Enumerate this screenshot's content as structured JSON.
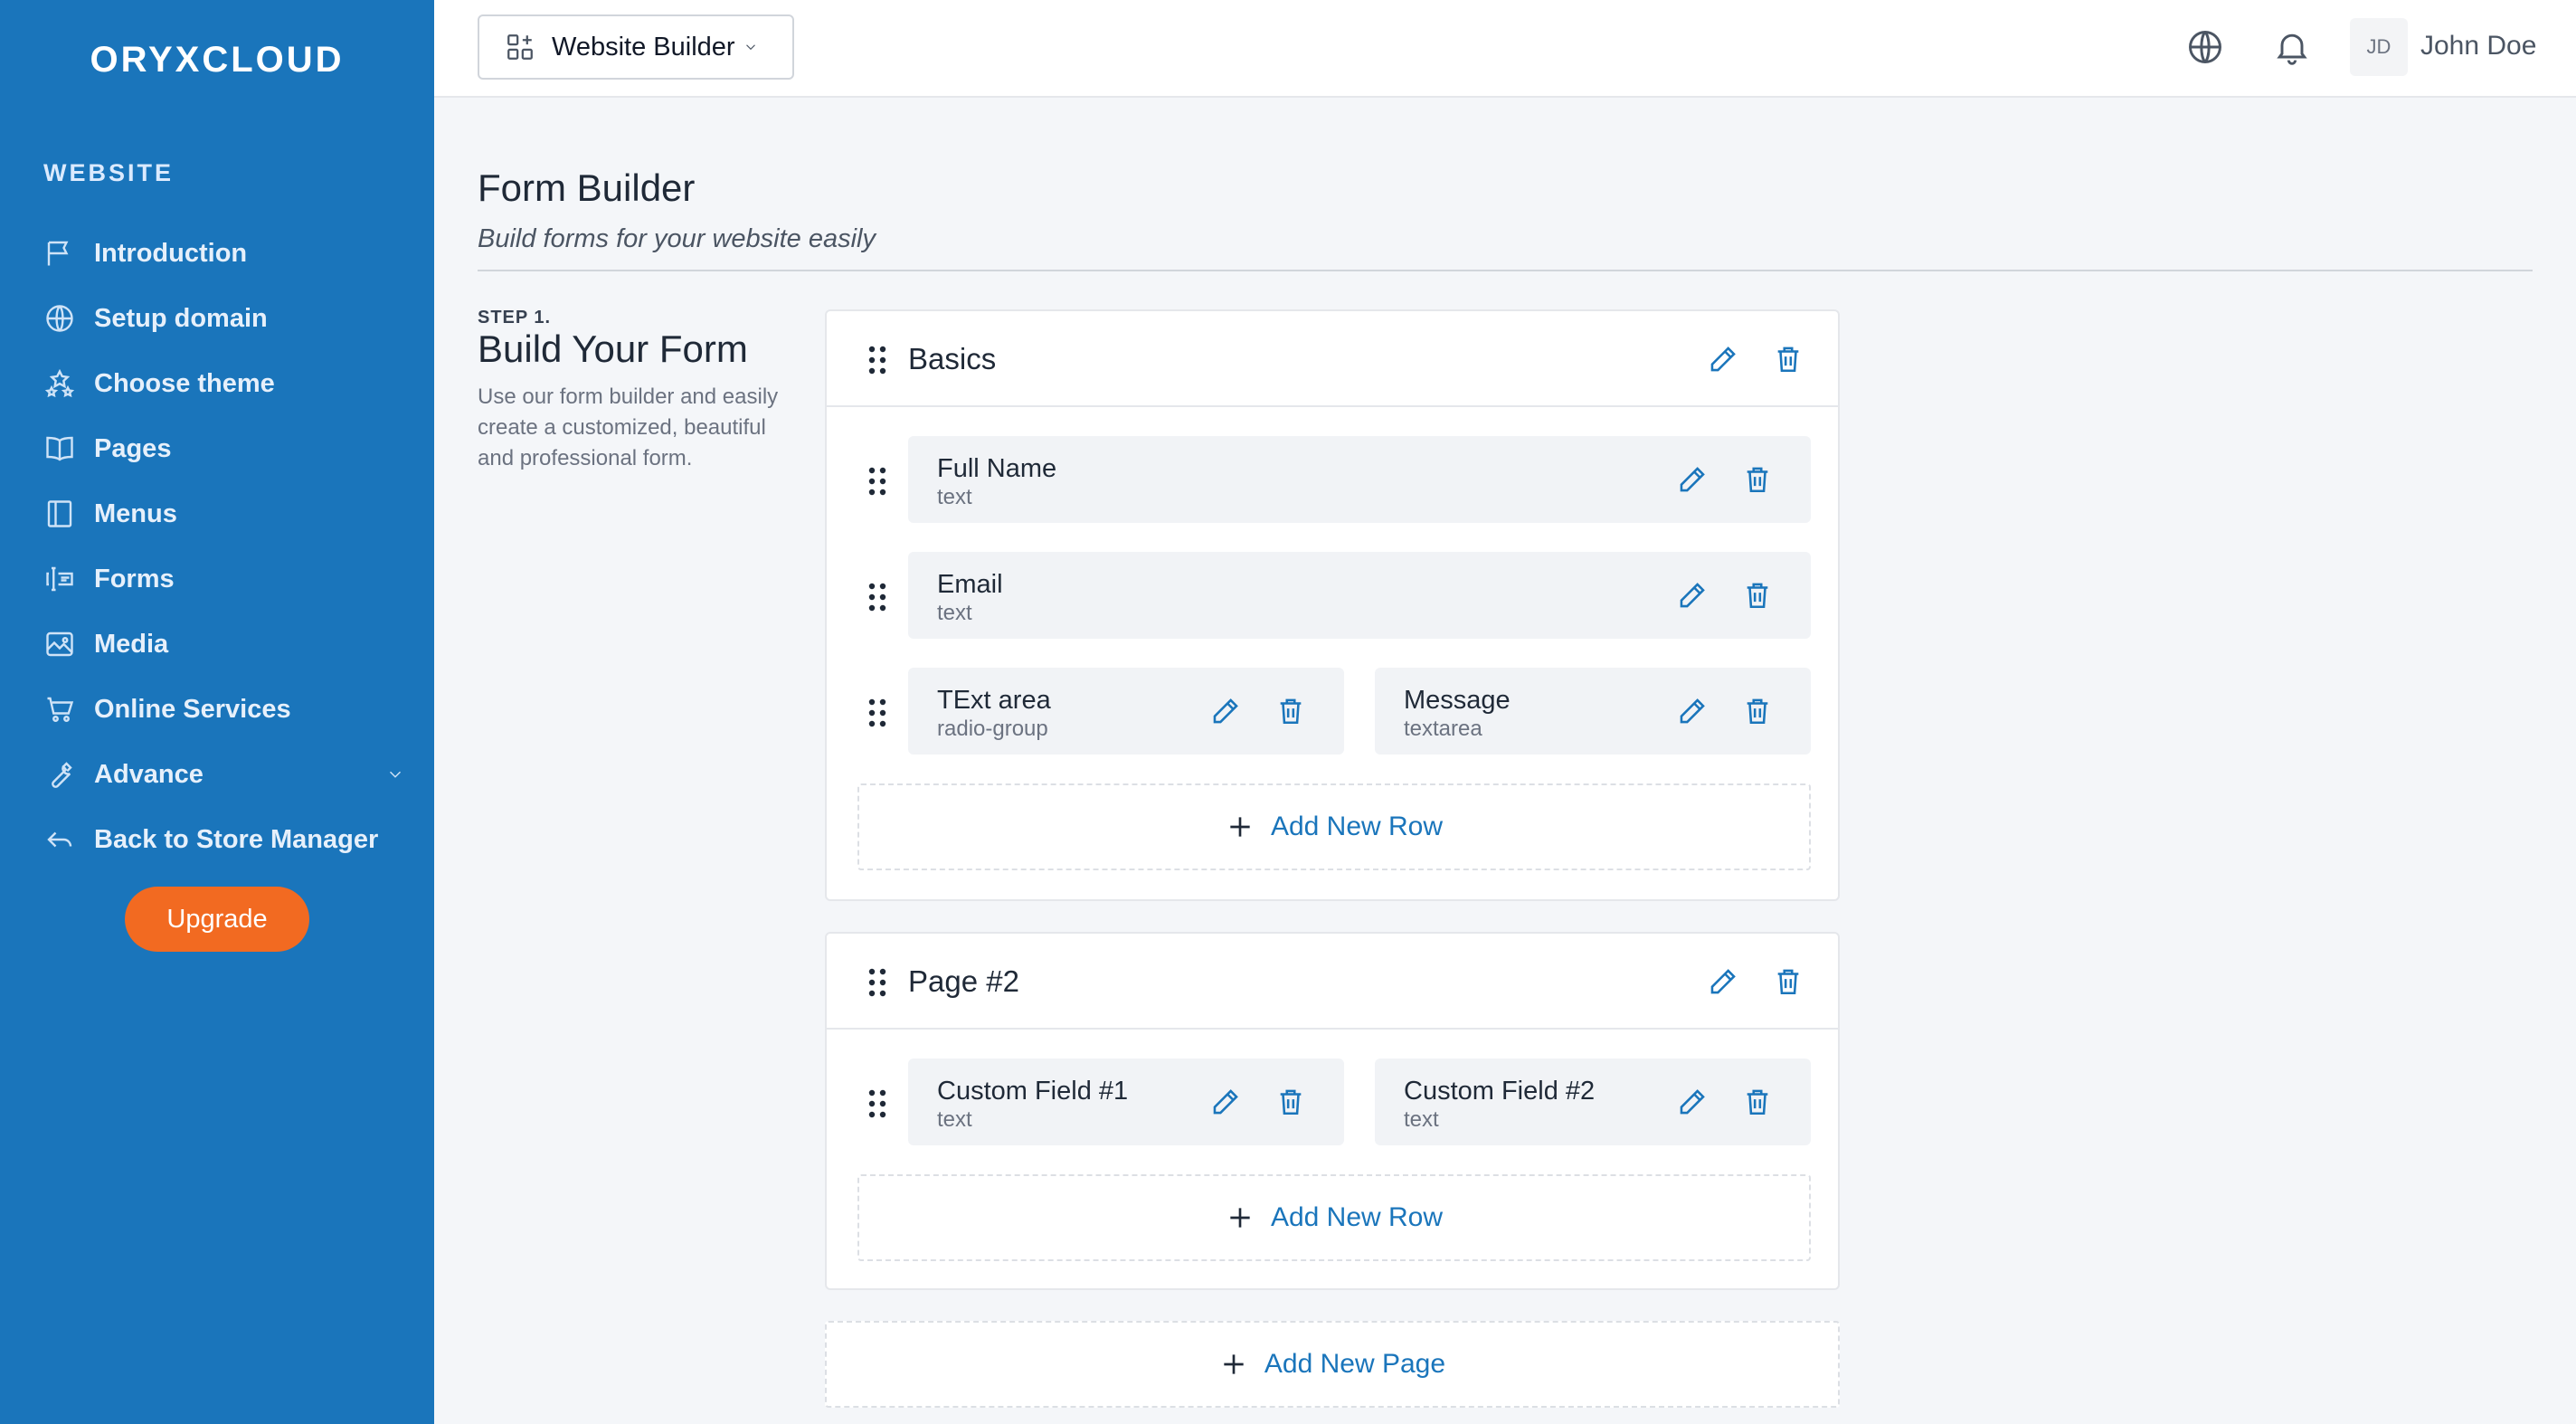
{
  "brand": {
    "logo": "ORYXCLOUD"
  },
  "sidebar": {
    "section_title": "WEBSITE",
    "items": [
      {
        "label": "Introduction",
        "icon": "flag-icon"
      },
      {
        "label": "Setup domain",
        "icon": "globe-icon"
      },
      {
        "label": "Choose theme",
        "icon": "stars-icon"
      },
      {
        "label": "Pages",
        "icon": "book-icon"
      },
      {
        "label": "Menus",
        "icon": "sidebar-layout-icon"
      },
      {
        "label": "Forms",
        "icon": "form-icon"
      },
      {
        "label": "Media",
        "icon": "image-icon"
      },
      {
        "label": "Online Services",
        "icon": "cart-icon"
      },
      {
        "label": "Advance",
        "icon": "wrench-icon"
      },
      {
        "label": "Back to Store Manager",
        "icon": "return-arrow-icon"
      }
    ],
    "upgrade_label": "Upgrade"
  },
  "topbar": {
    "app_switcher_label": "Website Builder",
    "avatar_initials": "JD",
    "user_name": "John Doe"
  },
  "header": {
    "title": "Form Builder",
    "subtitle": "Build forms for your website easily"
  },
  "step": {
    "label": "STEP 1.",
    "title": "Build Your Form",
    "description": "Use our form builder and easily create a customized, beautiful and professional form."
  },
  "form_pages": [
    {
      "title": "Basics",
      "rows": [
        [
          {
            "label": "Full Name",
            "type": "text"
          }
        ],
        [
          {
            "label": "Email",
            "type": "text"
          }
        ],
        [
          {
            "label": "TExt area",
            "type": "radio-group"
          },
          {
            "label": "Message",
            "type": "textarea"
          }
        ]
      ],
      "add_row_label": "Add New Row"
    },
    {
      "title": "Page #2",
      "rows": [
        [
          {
            "label": "Custom Field #1",
            "type": "text"
          },
          {
            "label": "Custom Field #2",
            "type": "text"
          }
        ]
      ],
      "add_row_label": "Add New Row"
    }
  ],
  "add_page_label": "Add New Page",
  "colors": {
    "sidebar": "#1a75bb",
    "accent": "#1a75bb",
    "upgrade": "#f26a21"
  }
}
